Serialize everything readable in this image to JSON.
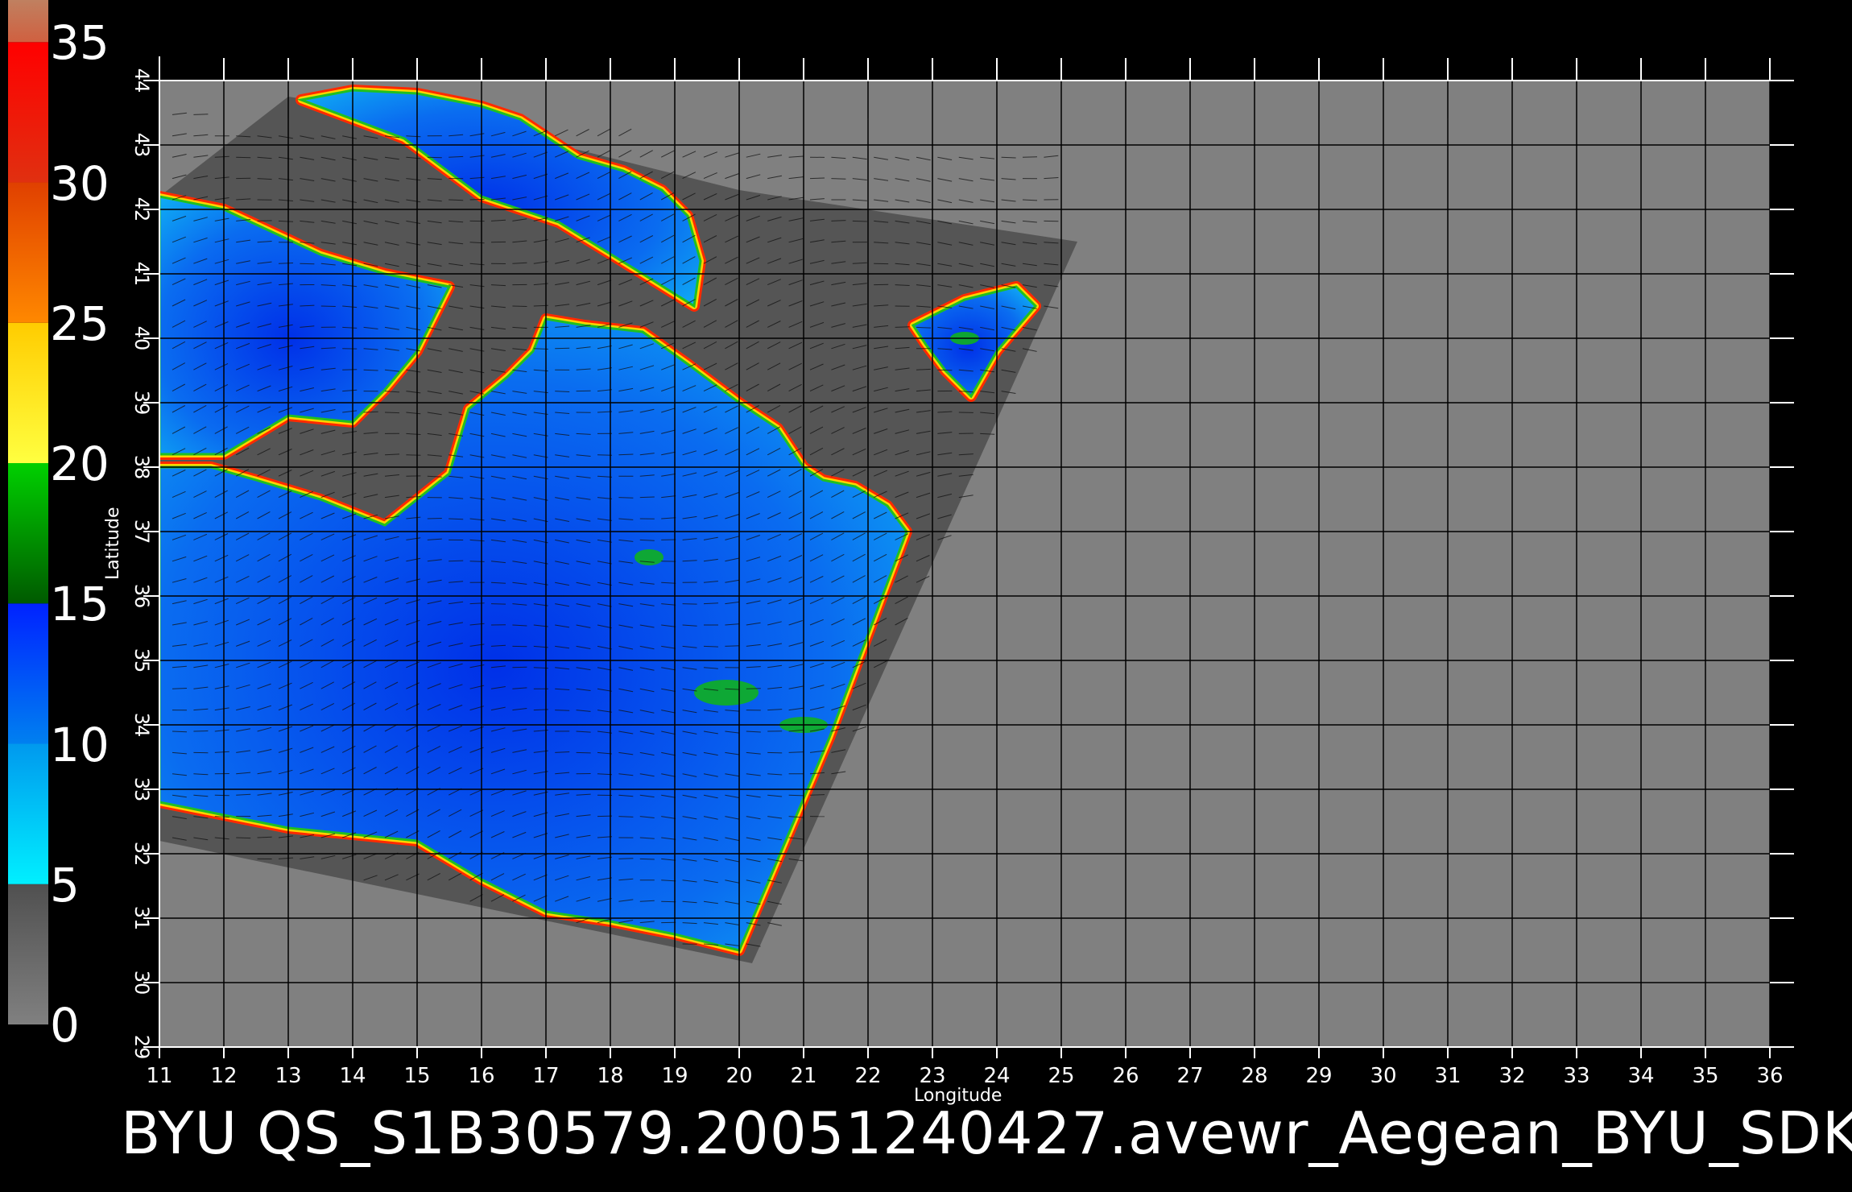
{
  "footer_text": "BYU  QS_S1B30579.20051240427.avewr_Aegean_BYU_SDK",
  "x_axis": {
    "title": "Longitude",
    "min": 11,
    "max": 36,
    "ticks": [
      11,
      12,
      13,
      14,
      15,
      16,
      17,
      18,
      19,
      20,
      21,
      22,
      23,
      24,
      25,
      26,
      27,
      28,
      29,
      30,
      31,
      32,
      33,
      34,
      35,
      36
    ]
  },
  "y_axis": {
    "title": "Latitude",
    "min": 29,
    "max": 44,
    "ticks": [
      29,
      30,
      31,
      32,
      33,
      34,
      35,
      36,
      37,
      38,
      39,
      40,
      41,
      42,
      43,
      44
    ]
  },
  "colorbar": {
    "min": 0,
    "max": 35,
    "labels": [
      "35",
      "30",
      "25",
      "20",
      "15",
      "10",
      "5",
      "0"
    ],
    "bands": [
      {
        "from": 0,
        "to": 5,
        "color_top": "#505050",
        "color_bottom": "#808080"
      },
      {
        "from": 5,
        "to": 10,
        "color_top": "#0099ee",
        "color_bottom": "#00f0ff"
      },
      {
        "from": 10,
        "to": 15,
        "color_top": "#0022ff",
        "color_bottom": "#0080f0"
      },
      {
        "from": 15,
        "to": 20,
        "color_top": "#00d000",
        "color_bottom": "#005a00"
      },
      {
        "from": 20,
        "to": 25,
        "color_top": "#ffcc00",
        "color_bottom": "#ffff40"
      },
      {
        "from": 25,
        "to": 30,
        "color_top": "#e04000",
        "color_bottom": "#ff8800"
      },
      {
        "from": 30,
        "to": 35,
        "color_top": "#ff0000",
        "color_bottom": "#e03010"
      },
      {
        "from": 35,
        "to": 36.5,
        "color_top": "#c08060",
        "color_bottom": "#d06040"
      }
    ]
  },
  "map": {
    "background_color": "#808080",
    "swath_color": "#555555",
    "land_color": "#4e4e4e",
    "swath_polygon": [
      [
        11,
        42.2
      ],
      [
        13,
        43.75
      ],
      [
        16,
        43.3
      ],
      [
        20,
        42.3
      ],
      [
        25.25,
        41.5
      ],
      [
        20.2,
        30.3
      ],
      [
        11,
        32.2
      ]
    ],
    "sea_regions": [
      [
        [
          11,
          38
        ],
        [
          11,
          32.8
        ],
        [
          13,
          32.4
        ],
        [
          15,
          32.2
        ],
        [
          16,
          31.6
        ],
        [
          17,
          31.1
        ],
        [
          18,
          30.95
        ],
        [
          19,
          30.75
        ],
        [
          20,
          30.5
        ],
        [
          21.4,
          33.8
        ],
        [
          22.6,
          37.0
        ],
        [
          22.3,
          37.4
        ],
        [
          21.8,
          37.7
        ],
        [
          21.3,
          37.8
        ],
        [
          21.0,
          38.0
        ],
        [
          20.6,
          38.6
        ],
        [
          20.0,
          39.0
        ],
        [
          19.2,
          39.6
        ],
        [
          18.5,
          40.1
        ],
        [
          17.6,
          40.2
        ],
        [
          17.0,
          40.3
        ],
        [
          16.8,
          39.8
        ],
        [
          16.4,
          39.4
        ],
        [
          15.8,
          38.9
        ],
        [
          15.5,
          37.9
        ],
        [
          15.0,
          37.5
        ],
        [
          14.5,
          37.1
        ],
        [
          13.5,
          37.5
        ],
        [
          12.5,
          37.8
        ],
        [
          11.8,
          38.0
        ],
        [
          11,
          38
        ]
      ],
      [
        [
          11,
          38.2
        ],
        [
          12,
          38.2
        ],
        [
          13,
          38.8
        ],
        [
          14,
          38.7
        ],
        [
          14.5,
          39.2
        ],
        [
          15,
          39.8
        ],
        [
          15.5,
          40.8
        ],
        [
          14.5,
          41.0
        ],
        [
          13.5,
          41.3
        ],
        [
          12,
          42.0
        ],
        [
          11,
          42.2
        ]
      ],
      [
        [
          13.2,
          43.7
        ],
        [
          14.8,
          43.1
        ],
        [
          16,
          42.2
        ],
        [
          17.2,
          41.8
        ],
        [
          18.5,
          41.0
        ],
        [
          19.3,
          40.5
        ],
        [
          19.4,
          41.2
        ],
        [
          19.2,
          41.9
        ],
        [
          18.8,
          42.3
        ],
        [
          18.2,
          42.6
        ],
        [
          17.5,
          42.8
        ],
        [
          16.6,
          43.4
        ],
        [
          16.0,
          43.6
        ],
        [
          15.0,
          43.8
        ],
        [
          14.0,
          43.85
        ]
      ],
      [
        [
          22.7,
          40.2
        ],
        [
          23.5,
          40.6
        ],
        [
          24.3,
          40.8
        ],
        [
          24.6,
          40.5
        ],
        [
          24.0,
          39.8
        ],
        [
          23.6,
          39.1
        ],
        [
          23.2,
          39.5
        ],
        [
          22.9,
          39.9
        ]
      ]
    ]
  }
}
